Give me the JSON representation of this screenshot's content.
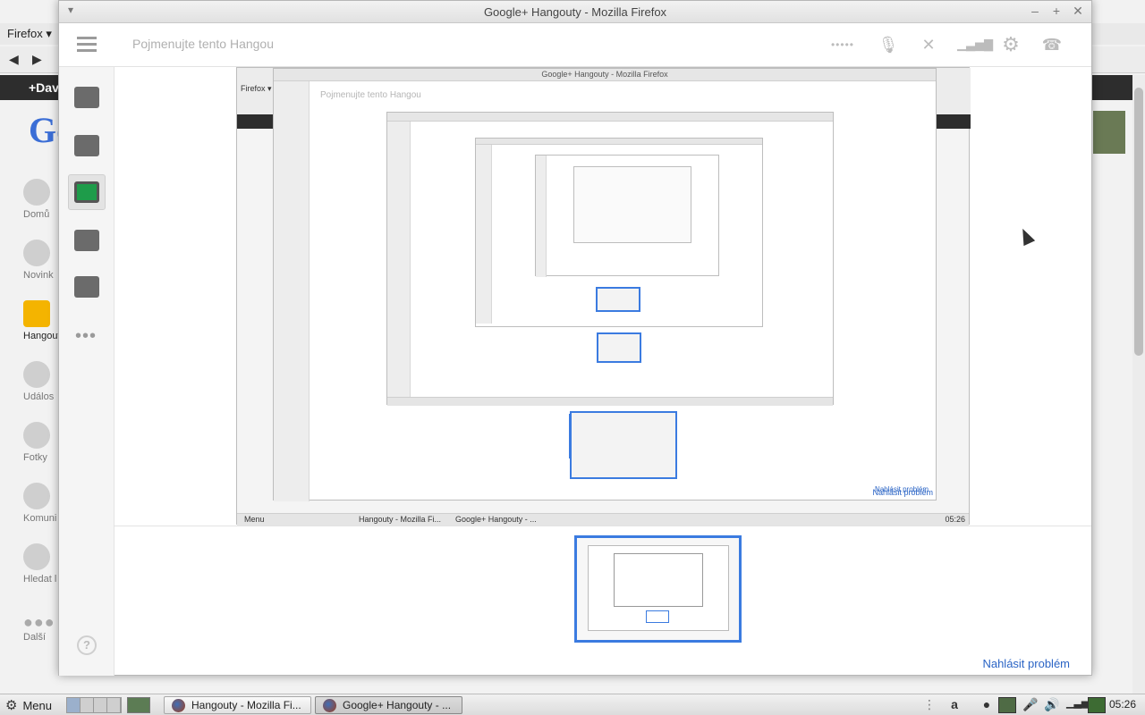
{
  "background_window": {
    "menu_label": "Firefox ▾",
    "gplus_user": "+Dav",
    "logo_text": "Go",
    "sidebar": [
      {
        "label": "Domů",
        "active": false
      },
      {
        "label": "Novink",
        "active": false
      },
      {
        "label": "Hangout",
        "active": true
      },
      {
        "label": "Událos",
        "active": false
      },
      {
        "label": "Fotky",
        "active": false
      },
      {
        "label": "Komuni",
        "active": false
      },
      {
        "label": "Hledat l",
        "active": false
      },
      {
        "label": "Další",
        "active": false
      }
    ]
  },
  "window": {
    "title": "Google+ Hangouty - Mozilla Firefox",
    "menu_glyph": "▾",
    "minimize": "–",
    "maximize": "+",
    "close": "✕"
  },
  "hangout": {
    "name_placeholder": "Pojmenujte tento Hangou",
    "header_icons": {
      "dots": "•••••",
      "mic": "🎙",
      "camera": "✕",
      "signal": "▁▃▅▇",
      "settings": "⚙",
      "hangup": "☎"
    },
    "help_glyph": "?",
    "more_glyph": "•••",
    "report_problem": "Nahlásit problém"
  },
  "nested": {
    "title": "Google+ Hangouty - Mozilla Firefox",
    "name_placeholder": "Pojmenujte tento Hangou",
    "menu_label": "Firefox ▾",
    "report_problem": "Nahlásit problém",
    "taskbar_menu": "Menu",
    "task1": "Hangouty - Mozilla Fi...",
    "task2": "Google+ Hangouty - ...",
    "clock": "05:26"
  },
  "taskbar": {
    "menu_label": "Menu",
    "task1": "Hangouty - Mozilla Fi...",
    "task2": "Google+ Hangouty - ...",
    "clock": "05:26",
    "tray_icons": [
      "more-icon",
      "amazon-icon",
      "chat-icon",
      "screen-icon",
      "mic-icon",
      "volume-icon",
      "network-icon",
      "battery-icon"
    ]
  }
}
